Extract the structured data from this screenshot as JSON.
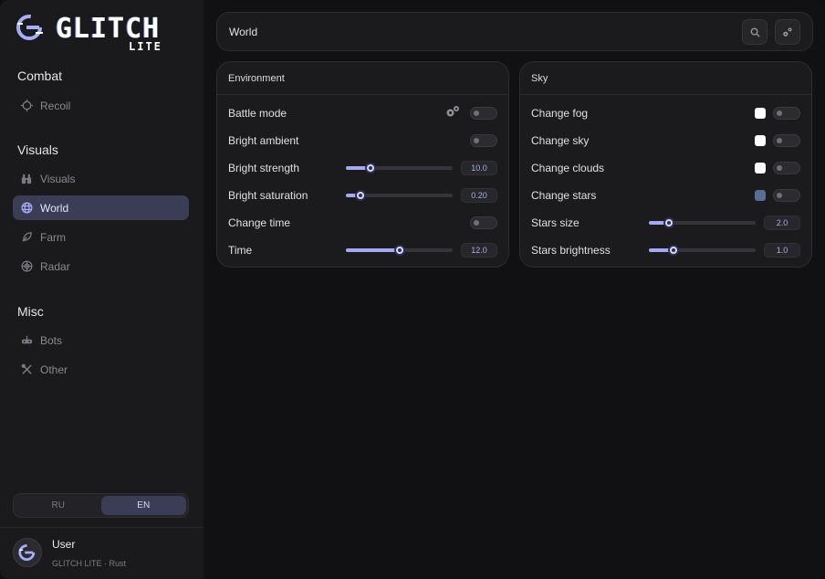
{
  "logo": {
    "word": "GLITCH",
    "sub": "LITE"
  },
  "sidebar": {
    "sections": [
      {
        "title": "Combat",
        "items": [
          {
            "label": "Recoil",
            "icon": "crosshair-icon"
          }
        ]
      },
      {
        "title": "Visuals",
        "items": [
          {
            "label": "Visuals",
            "icon": "binoculars-icon"
          },
          {
            "label": "World",
            "icon": "globe-icon",
            "active": true
          },
          {
            "label": "Farm",
            "icon": "leaf-icon"
          },
          {
            "label": "Radar",
            "icon": "radar-icon"
          }
        ]
      },
      {
        "title": "Misc",
        "items": [
          {
            "label": "Bots",
            "icon": "robot-icon"
          },
          {
            "label": "Other",
            "icon": "tools-icon"
          }
        ]
      }
    ],
    "language": {
      "options": [
        "RU",
        "EN"
      ],
      "selected": "EN"
    },
    "user": {
      "name": "User",
      "subtitle": "GLITCH LITE · Rust"
    }
  },
  "header": {
    "title": "World"
  },
  "panels": [
    {
      "title": "Environment",
      "rows": [
        {
          "label": "Battle mode",
          "type": "toggle",
          "on": false,
          "has_settings": true
        },
        {
          "label": "Bright ambient",
          "type": "toggle",
          "on": false
        },
        {
          "label": "Bright strength",
          "type": "slider",
          "fraction": 0.23,
          "value": "10.0"
        },
        {
          "label": "Bright saturation",
          "type": "slider",
          "fraction": 0.14,
          "value": "0.20"
        },
        {
          "label": "Change time",
          "type": "toggle",
          "on": false
        },
        {
          "label": "Time",
          "type": "slider",
          "fraction": 0.5,
          "value": "12.0"
        }
      ]
    },
    {
      "title": "Sky",
      "rows": [
        {
          "label": "Change fog",
          "type": "color-toggle",
          "color": "#ffffff",
          "on": false
        },
        {
          "label": "Change sky",
          "type": "color-toggle",
          "color": "#ffffff",
          "on": false
        },
        {
          "label": "Change clouds",
          "type": "color-toggle",
          "color": "#ffffff",
          "on": false
        },
        {
          "label": "Change stars",
          "type": "color-toggle",
          "color": "#5a6e92",
          "on": false
        },
        {
          "label": "Stars size",
          "type": "slider",
          "fraction": 0.19,
          "value": "2.0"
        },
        {
          "label": "Stars brightness",
          "type": "slider",
          "fraction": 0.23,
          "value": "1.0"
        }
      ]
    }
  ],
  "colors": {
    "accent": "#a3aaf3",
    "active_bg": "#3b3c56",
    "sidebar_bg": "#1a1a1d",
    "panel_bg": "#1b1b1e"
  }
}
